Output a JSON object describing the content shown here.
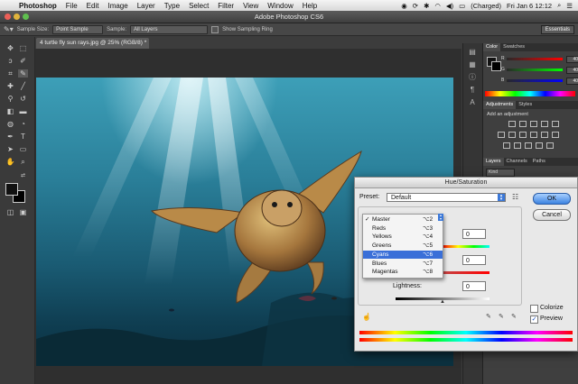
{
  "menubar": {
    "app": "Photoshop",
    "items": [
      "File",
      "Edit",
      "Image",
      "Layer",
      "Type",
      "Select",
      "Filter",
      "View",
      "Window",
      "Help"
    ],
    "battery": "(Charged)",
    "clock": "Fri Jan 6  12:12"
  },
  "window": {
    "title": "Adobe Photoshop CS6"
  },
  "options": {
    "sample_size_label": "Sample Size:",
    "sample_size_value": "Point Sample",
    "sample_label": "Sample:",
    "sample_value": "All Layers",
    "show_ring_label": "Show Sampling Ring",
    "workspace": "Essentials"
  },
  "document": {
    "tab": "4 turtle fly sun rays.jpg @ 25% (RGB/8) *"
  },
  "panels": {
    "color_tabs": [
      "Color",
      "Swatches"
    ],
    "rgb": [
      {
        "ch": "R",
        "value": "40"
      },
      {
        "ch": "G",
        "value": "40"
      },
      {
        "ch": "B",
        "value": "40"
      }
    ],
    "adj_tabs": [
      "Adjustments",
      "Styles"
    ],
    "adj_label": "Add an adjustment",
    "layers_tabs": [
      "Layers",
      "Channels",
      "Paths"
    ],
    "kind": "Kind"
  },
  "dialog": {
    "title": "Hue/Saturation",
    "preset_label": "Preset:",
    "preset_value": "Default",
    "ok": "OK",
    "cancel": "Cancel",
    "hue_value": "0",
    "saturation_value": "0",
    "lightness_label": "Lightness:",
    "lightness_value": "0",
    "colorize": "Colorize",
    "preview": "Preview",
    "preview_checked": true,
    "colorize_checked": false,
    "menu": [
      {
        "name": "Master",
        "shortcut": "⌥2",
        "checked": true,
        "selected": false
      },
      {
        "name": "Reds",
        "shortcut": "⌥3",
        "checked": false,
        "selected": false
      },
      {
        "name": "Yellows",
        "shortcut": "⌥4",
        "checked": false,
        "selected": false
      },
      {
        "name": "Greens",
        "shortcut": "⌥5",
        "checked": false,
        "selected": false
      },
      {
        "name": "Cyans",
        "shortcut": "⌥6",
        "checked": false,
        "selected": true
      },
      {
        "name": "Blues",
        "shortcut": "⌥7",
        "checked": false,
        "selected": false
      },
      {
        "name": "Magentas",
        "shortcut": "⌥8",
        "checked": false,
        "selected": false
      }
    ]
  },
  "colors": {
    "accent": "#3a6fd8",
    "panel": "#3f3f3f"
  }
}
